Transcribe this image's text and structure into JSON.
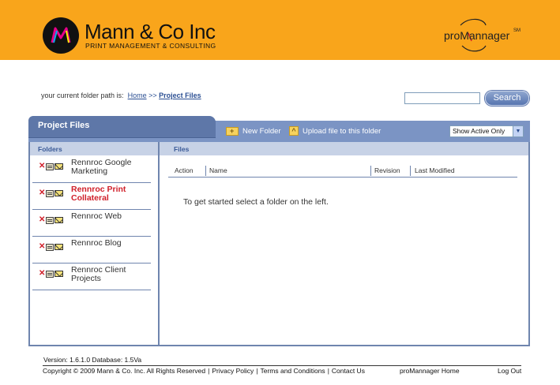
{
  "brand": {
    "name": "Mann & Co Inc",
    "tagline": "PRINT MANAGEMENT & CONSULTING",
    "logo_letter": "M",
    "product_logo_text": "proMannager",
    "product_logo_mark": "SM",
    "colors": {
      "header": "#f9a51b",
      "panel": "#7b94c4",
      "accent": "#2b4f93",
      "active": "#d0202a"
    }
  },
  "breadcrumb": {
    "prefix": "your current folder path is:",
    "home": "Home",
    "separator": ">>",
    "current": "Project Files"
  },
  "search": {
    "value": "",
    "button": "Search"
  },
  "panel": {
    "title": "Project Files",
    "new_folder": "New Folder",
    "upload": "Upload file to this folder",
    "filter_selected": "Show Active Only",
    "folders_header": "Folders",
    "files_header": "Files"
  },
  "folders": [
    {
      "label": "Rennroc Google Marketing",
      "active": false,
      "icons": [
        "delete-icon",
        "properties-icon",
        "mail-icon"
      ]
    },
    {
      "label": "Rennroc Print Collateral",
      "active": true,
      "icons": [
        "delete-icon",
        "properties-icon",
        "mail-icon"
      ]
    },
    {
      "label": "Rennroc Web",
      "active": false,
      "icons": [
        "delete-icon",
        "properties-icon",
        "mail-icon"
      ]
    },
    {
      "label": "Rennroc Blog",
      "active": false,
      "icons": [
        "delete-icon",
        "properties-icon",
        "mail-icon"
      ]
    },
    {
      "label": "Rennroc Client Projects",
      "active": false,
      "icons": [
        "delete-icon",
        "properties-icon",
        "mail-icon"
      ]
    }
  ],
  "files_table": {
    "columns": [
      "Action",
      "Name",
      "Revision",
      "Last Modified"
    ],
    "empty_message": "To get started select a folder on the left."
  },
  "footer": {
    "version": "Version: 1.6.1.0 Database: 1.5Va",
    "copyright": "Copyright © 2009 Mann & Co. Inc. All Rights Reserved",
    "privacy": "Privacy Policy",
    "terms": "Terms and Conditions",
    "contact": "Contact Us",
    "home": "proMannager Home",
    "logout": "Log Out"
  }
}
